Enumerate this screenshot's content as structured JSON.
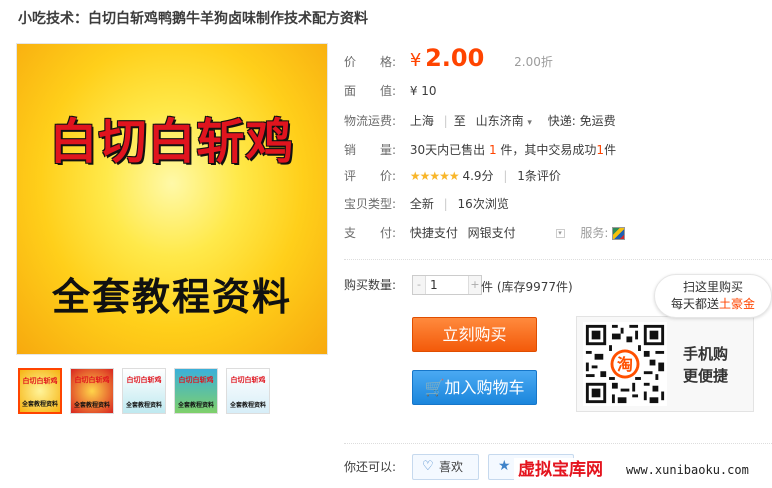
{
  "title": "小吃技术：白切白斩鸡鸭鹅牛羊狗卤味制作技术配方资料",
  "main_image": {
    "line1": "白切白斩鸡",
    "line2": "全套教程资料"
  },
  "thumbnails": [
    {
      "top": "白切白斩鸡",
      "bottom": "全套教程资料"
    },
    {
      "top": "白切白斩鸡",
      "bottom": "全套教程资料"
    },
    {
      "top": "白切白斩鸡",
      "bottom": "全套教程资料"
    },
    {
      "top": "白切白斩鸡",
      "bottom": "全套教程资料"
    },
    {
      "top": "白切白斩鸡",
      "bottom": "全套教程资料"
    }
  ],
  "props": {
    "price_label": "价　　格:",
    "price_symbol": "¥",
    "price": "2.00",
    "original": "2.00折",
    "face_label": "面　　值:",
    "face_value": "¥ 10",
    "shipping_label": "物流运费:",
    "ship_from": "上海",
    "ship_to_prefix": "至",
    "ship_to": "山东济南",
    "ship_method": "快递: 免运费",
    "sales_label": "销　　量:",
    "sales_a": "30天内已售出",
    "sales_n1": "1",
    "sales_b": "件，其中交易成功",
    "sales_n2": "1",
    "sales_c": "件",
    "rating_label": "评　　价:",
    "stars": "★★★★★",
    "score": "4.9分",
    "reviews": "1条评价",
    "type_label": "宝贝类型:",
    "type_value": "全新",
    "views": "16次浏览",
    "pay_label": "支　　付:",
    "pay1": "快捷支付",
    "pay2": "网银支付",
    "service_label": "服务:"
  },
  "purchase": {
    "qty_label": "购买数量:",
    "qty_minus": "-",
    "qty_value": "1",
    "qty_plus": "+",
    "stock": "件 (库存9977件)",
    "buy_now": "立刻购买",
    "add_cart": "加入购物车"
  },
  "promo": {
    "line1": "扫这里购买",
    "line2_a": "每天都送",
    "line2_b": "土豪金",
    "qr_text1": "手机购",
    "qr_text2": "更便捷",
    "qr_center": "淘"
  },
  "share": {
    "label": "你还可以:",
    "like": "喜欢"
  },
  "watermark": {
    "cn": "虚拟宝库网",
    "url": "www.xunibaoku.com"
  },
  "colors": {
    "accent": "#ff4400",
    "buy": "#f35a0a",
    "cart": "#1b86dc",
    "star": "#f8b62b"
  }
}
